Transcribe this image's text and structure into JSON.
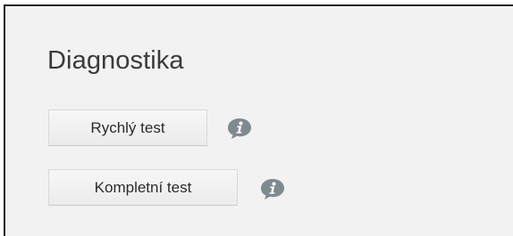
{
  "section": {
    "title": "Diagnostika"
  },
  "buttons": {
    "quick_test_label": "Rychlý test",
    "full_test_label": "Kompletní test"
  },
  "icons": {
    "info": "info-icon"
  },
  "colors": {
    "panel_background": "#f2f2f2",
    "button_background": "#efefef",
    "info_icon": "#7f8990",
    "text": "#3a3a3a"
  }
}
